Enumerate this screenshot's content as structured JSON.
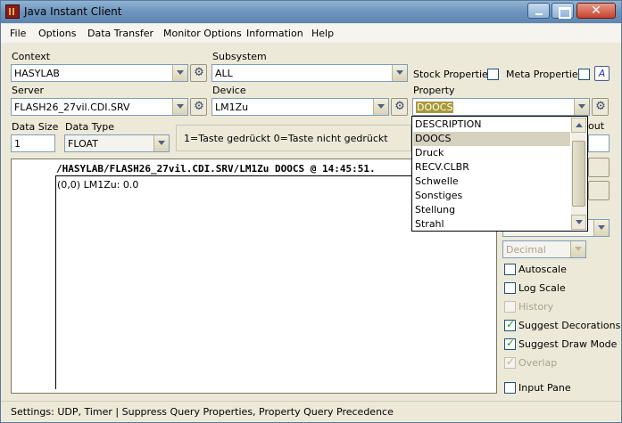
{
  "window": {
    "title": "Java Instant Client"
  },
  "menu": [
    "File",
    "Options",
    "Data Transfer",
    "Monitor Options",
    "Information",
    "Help"
  ],
  "context": {
    "label": "Context",
    "value": "HASYLAB"
  },
  "subsystem": {
    "label": "Subsystem",
    "value": "ALL"
  },
  "server": {
    "label": "Server",
    "value": "FLASH26_27vil.CDI.SRV"
  },
  "device": {
    "label": "Device",
    "value": "LM1Zu"
  },
  "property": {
    "label": "Property",
    "value": "DOOCS"
  },
  "stock_properties": {
    "label": "Stock Properties",
    "checked": false
  },
  "meta_properties": {
    "label": "Meta Properties",
    "checked": false
  },
  "datasize": {
    "label": "Data Size",
    "value": "1"
  },
  "datatype": {
    "label": "Data Type",
    "value": "FLOAT"
  },
  "hint": {
    "text": "1=Taste gedrückt  0=Taste nicht gedrückt"
  },
  "property_dropdown": {
    "items": [
      "DESCRIPTION",
      "DOOCS",
      "Druck",
      "RECV.CLBR",
      "Schwelle",
      "Sonstiges",
      "Stellung",
      "Strahl"
    ],
    "selected": "DOOCS"
  },
  "right_panel": {
    "out_label": "out",
    "format": "Decimal",
    "checks": [
      {
        "label": "Autoscale",
        "checked": false,
        "enabled": true
      },
      {
        "label": "Log Scale",
        "checked": false,
        "enabled": true
      },
      {
        "label": "History",
        "checked": false,
        "enabled": false
      },
      {
        "label": "Suggest Decorations",
        "checked": true,
        "enabled": true
      },
      {
        "label": "Suggest Draw Mode",
        "checked": true,
        "enabled": true
      },
      {
        "label": "Overlap",
        "checked": true,
        "enabled": false
      },
      {
        "label": "Input Pane",
        "checked": false,
        "enabled": true
      }
    ]
  },
  "plot": {
    "title": "/HASYLAB/FLASH26_27vil.CDI.SRV/LM1Zu DOOCS @ 14:45:51.",
    "line": "(0,0)  LM1Zu: 0.0"
  },
  "status": {
    "text": "Settings: UDP, Timer | Suppress Query Properties, Property Query Precedence"
  }
}
